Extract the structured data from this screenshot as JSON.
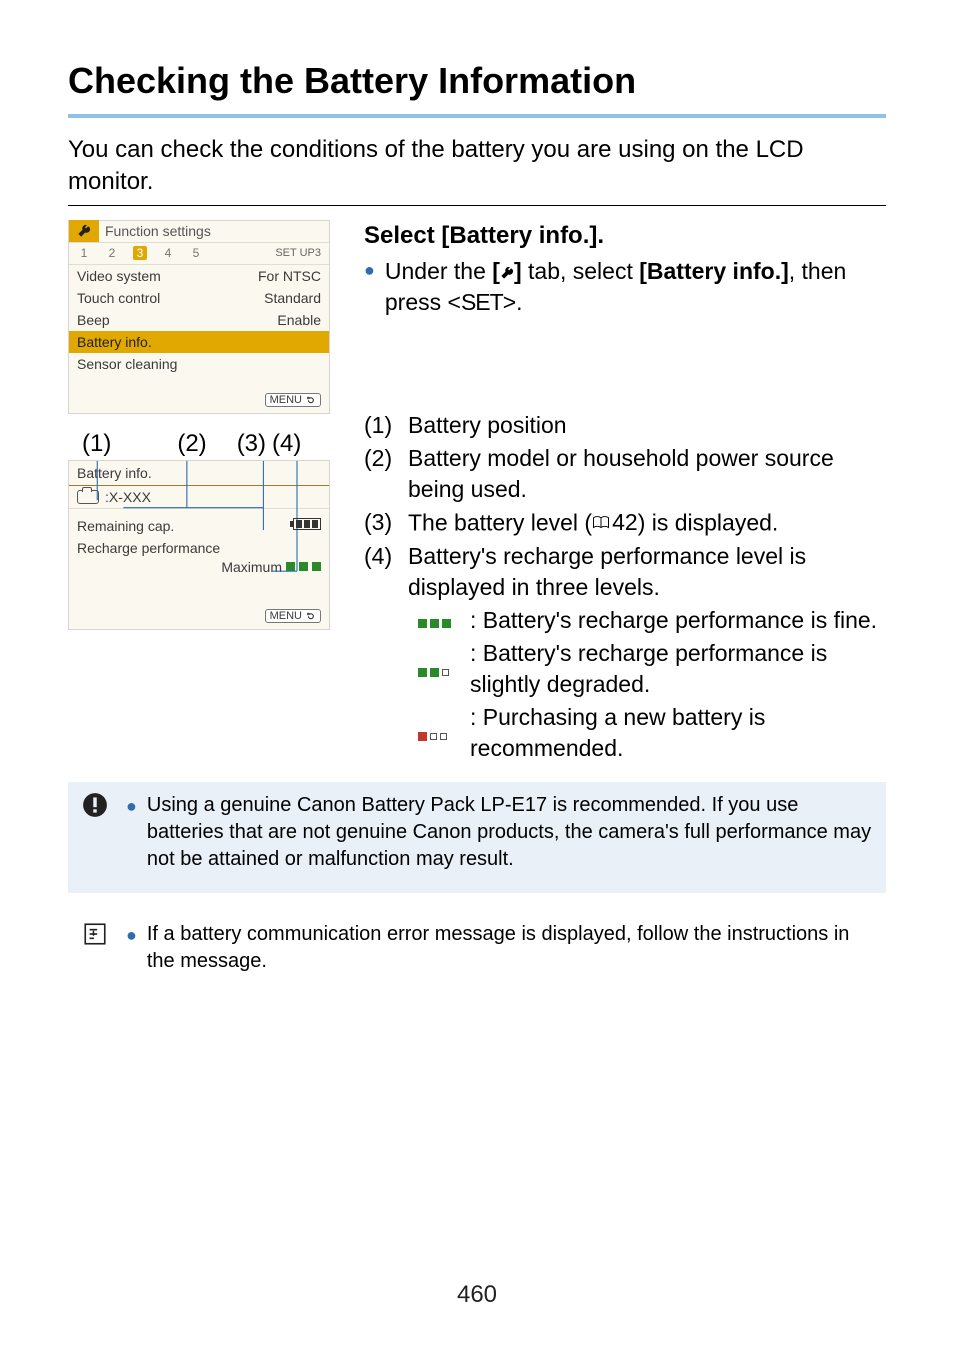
{
  "page": {
    "title": "Checking the Battery Information",
    "intro": "You can check the conditions of the battery you are using on the LCD monitor.",
    "number": "460"
  },
  "menu_screen": {
    "header": "Function settings",
    "tabs": [
      "1",
      "2",
      "3",
      "4",
      "5"
    ],
    "selected_tab": "3",
    "setup_label": "SET UP3",
    "items": [
      {
        "name": "Video system",
        "value": "For NTSC"
      },
      {
        "name": "Touch control",
        "value": "Standard"
      },
      {
        "name": "Beep",
        "value": "Enable"
      },
      {
        "name": "Battery info.",
        "value": ""
      },
      {
        "name": "Sensor cleaning",
        "value": ""
      }
    ],
    "highlighted": "Battery info.",
    "menu_label": "MENU"
  },
  "callouts": {
    "c1": "(1)",
    "c2": "(2)",
    "c3": "(3)",
    "c4": "(4)"
  },
  "info_screen": {
    "title": "Battery info.",
    "model_prefix": ":X-XXX",
    "remaining_label": "Remaining cap.",
    "recharge_label": "Recharge performance",
    "recharge_value": "Maximum",
    "menu_label": "MENU"
  },
  "right": {
    "step_title": "Select [Battery info.].",
    "step_text_1": "Under the ",
    "step_text_2": " tab, select ",
    "step_text_3": "[Battery info.]",
    "step_text_4": ", then press <",
    "set_key": "SET",
    "step_text_5": ">.",
    "l1_n": "(1)",
    "l1_t": "Battery position",
    "l2_n": "(2)",
    "l2_t": "Battery model or household power source being used.",
    "l3_n": "(3)",
    "l3_t_a": "The battery level (",
    "l3_ref": "42",
    "l3_t_b": ") is displayed.",
    "l4_n": "(4)",
    "l4_t": "Battery's recharge performance level is displayed in three levels.",
    "s1": ": Battery's recharge performance is fine.",
    "s2": ": Battery's recharge performance is slightly degraded.",
    "s3": ": Purchasing a new battery is recommended."
  },
  "notes": {
    "caution": "Using a genuine Canon Battery Pack LP-E17 is recommended. If you use batteries that are not genuine Canon products, the camera's full performance may not be attained or malfunction may result.",
    "info": "If a battery communication error message is displayed, follow the instructions in the message."
  }
}
